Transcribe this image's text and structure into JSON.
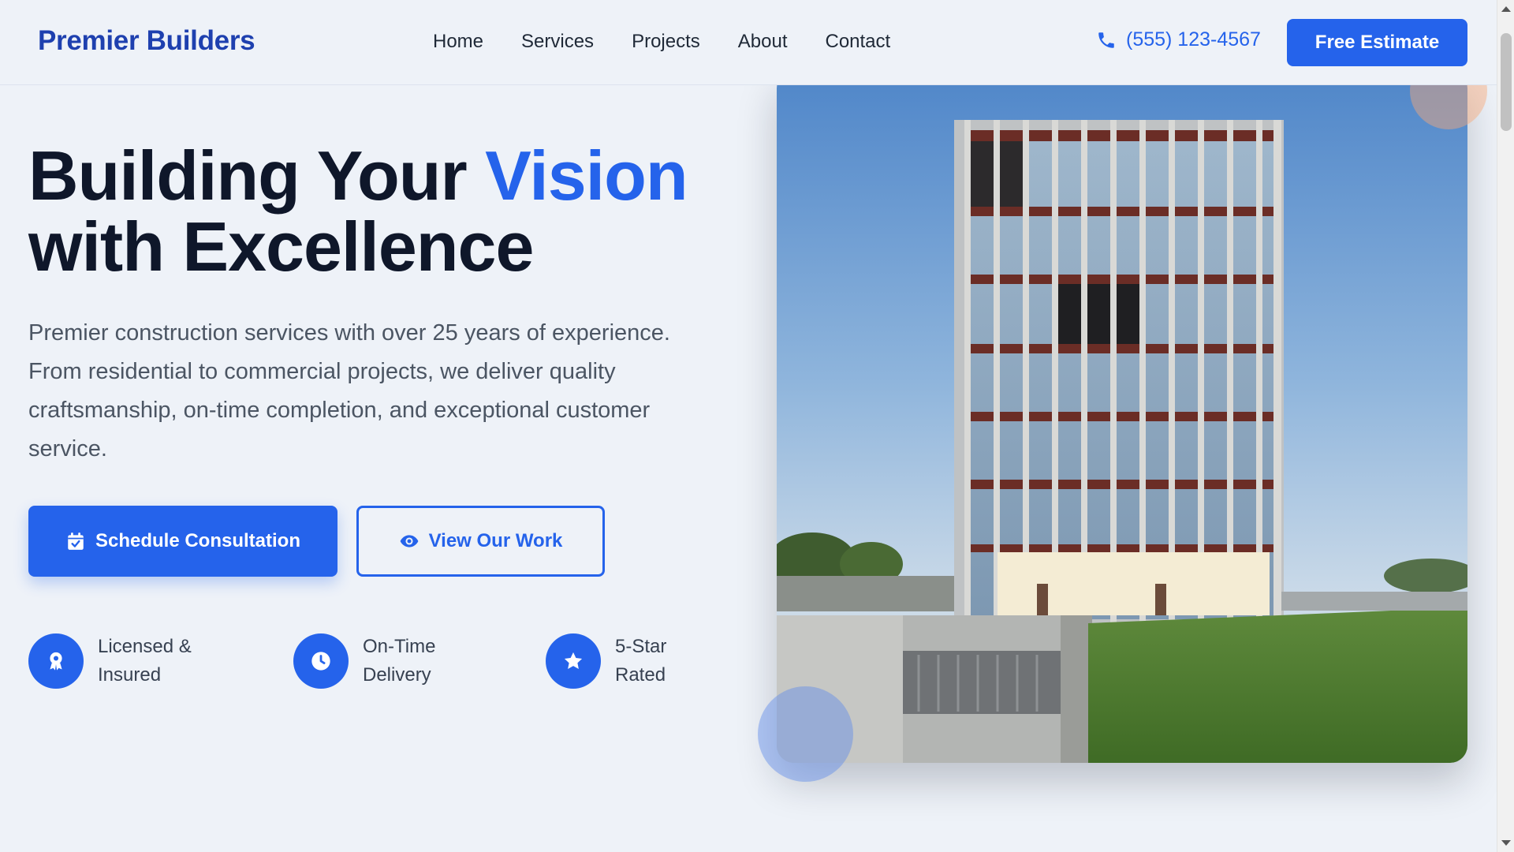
{
  "header": {
    "brand": "Premier Builders",
    "nav": [
      "Home",
      "Services",
      "Projects",
      "About",
      "Contact"
    ],
    "phone": "(555) 123-4567",
    "cta": "Free Estimate"
  },
  "hero": {
    "title_part1": "Building Your ",
    "title_accent": "Vision",
    "title_part2": "with Excellence",
    "description": "Premier construction services with over 25 years of experience. From residential to commercial projects, we deliver quality craftsmanship, on-time completion, and exceptional customer service.",
    "primary_button": "Schedule Consultation",
    "secondary_button": "View Our Work",
    "features": [
      {
        "line1": "Licensed &",
        "line2": "Insured",
        "icon": "award-icon"
      },
      {
        "line1": "On-Time",
        "line2": "Delivery",
        "icon": "clock-icon"
      },
      {
        "line1": "5-Star",
        "line2": "Rated",
        "icon": "star-icon"
      }
    ]
  },
  "colors": {
    "accent": "#2563eb",
    "brand": "#1e40af",
    "background": "#eef2f8",
    "text": "#0f172a"
  }
}
